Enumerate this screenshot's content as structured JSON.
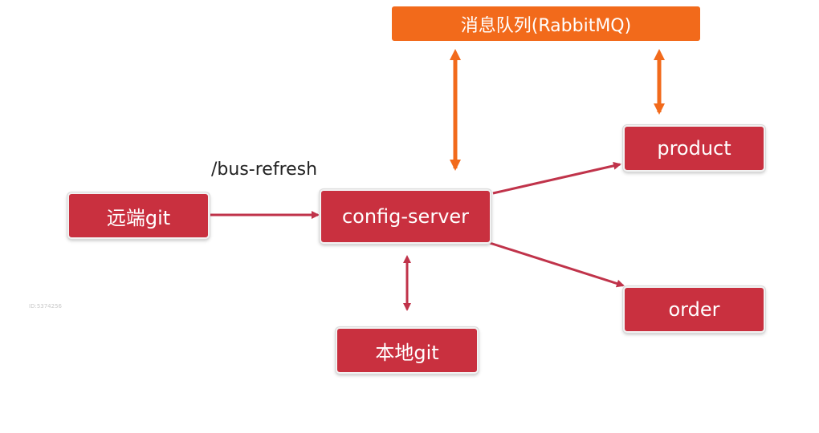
{
  "nodes": {
    "mq": "消息队列(RabbitMQ)",
    "remote_git": "远端git",
    "config_server": "config-server",
    "local_git": "本地git",
    "product": "product",
    "order": "order"
  },
  "edge_labels": {
    "bus_refresh": "/bus-refresh"
  },
  "watermark": "ID:5374256",
  "colors": {
    "node_red": "#c9303f",
    "node_orange": "#f26a1b",
    "arrow_red": "#c0334a",
    "arrow_orange": "#f26a1b"
  }
}
